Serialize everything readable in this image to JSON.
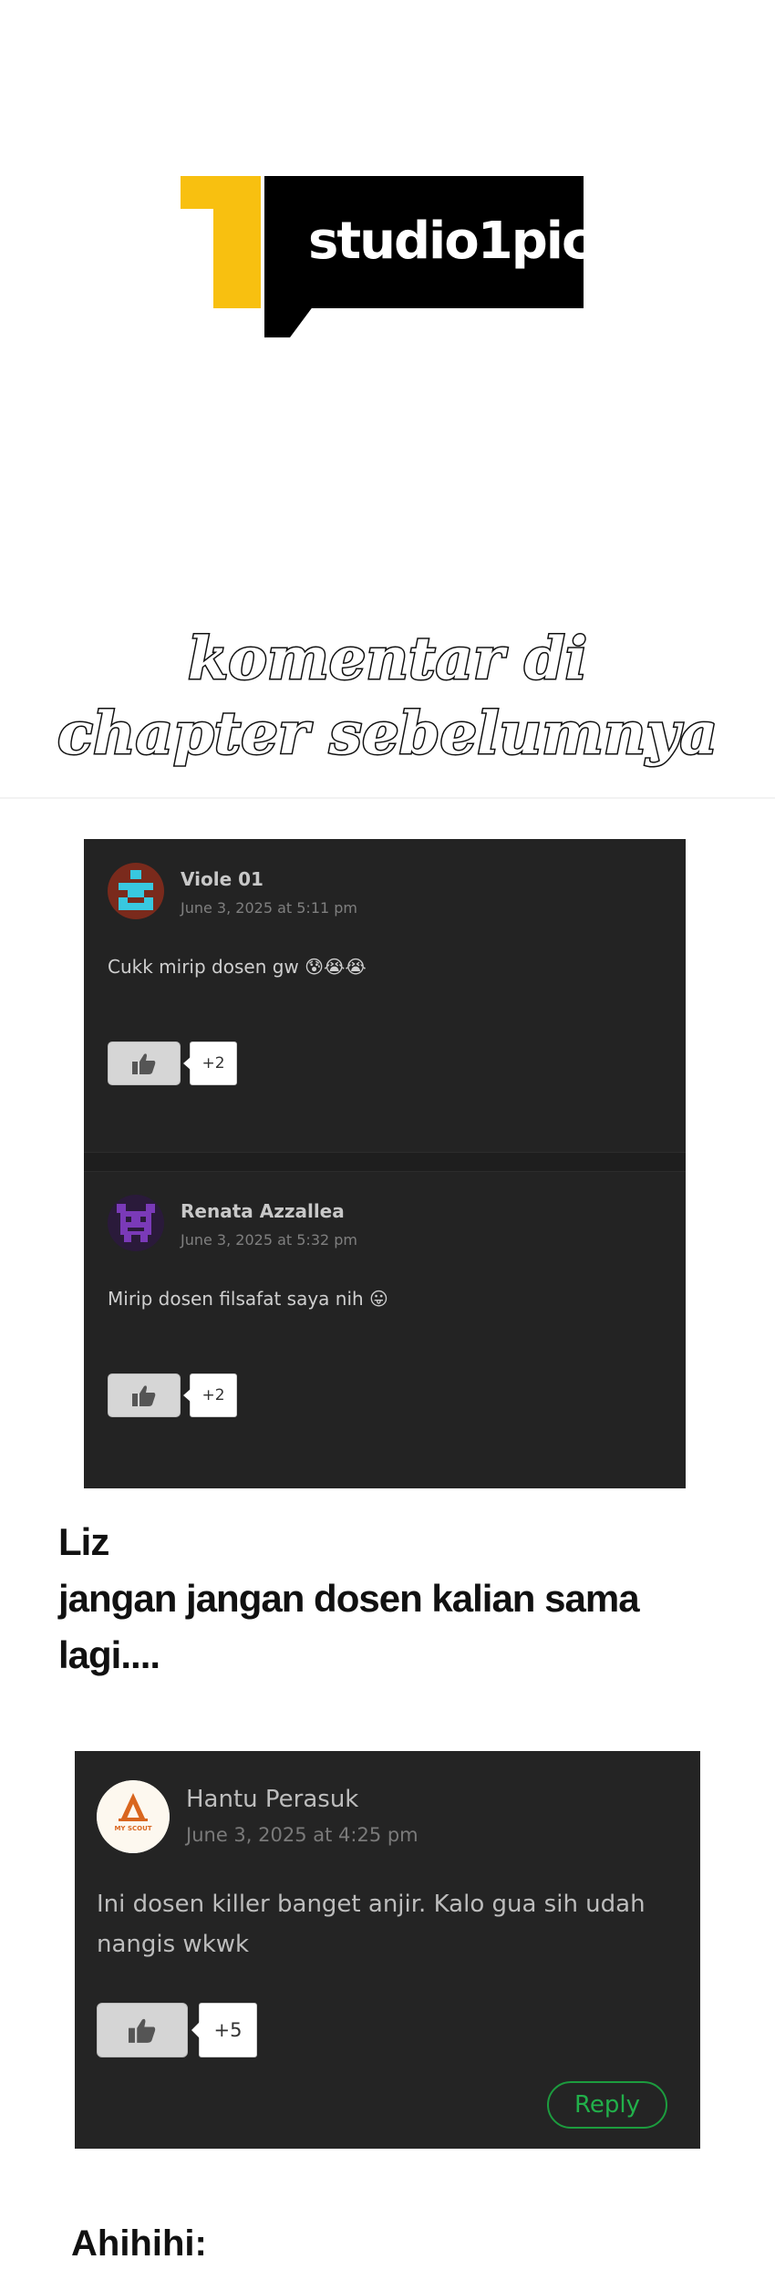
{
  "logo": {
    "brand": "studio1pic"
  },
  "heading": {
    "line1": "komentar di",
    "line2": "chapter sebelumnya"
  },
  "panel1": {
    "comments": [
      {
        "name": "Viole 01",
        "date": "June 3, 2025 at 5:11 pm",
        "text": "Cukk mirip dosen gw 😰😭😭",
        "likes": "+2"
      },
      {
        "name": "Renata Azzallea",
        "date": "June 3, 2025 at 5:32 pm",
        "text": "Mirip dosen filsafat saya nih 😛",
        "likes": "+2"
      }
    ]
  },
  "narration": {
    "line1": "Liz",
    "line2": "jangan jangan dosen kalian sama",
    "line3": "lagi...."
  },
  "panel2": {
    "name": "Hantu Perasuk",
    "date": "June 3, 2025 at 4:25 pm",
    "text_line1": "Ini dosen killer banget anjir. Kalo gua sih udah",
    "text_line2": "nangis wkwk",
    "likes": "+5",
    "reply": "Reply",
    "avatar_text": "MY SCOUT"
  },
  "narration2": "Ahihihi:",
  "colors": {
    "logo_yellow": "#f8c010",
    "panel_bg": "#232323",
    "reply_green": "#21b04a"
  }
}
